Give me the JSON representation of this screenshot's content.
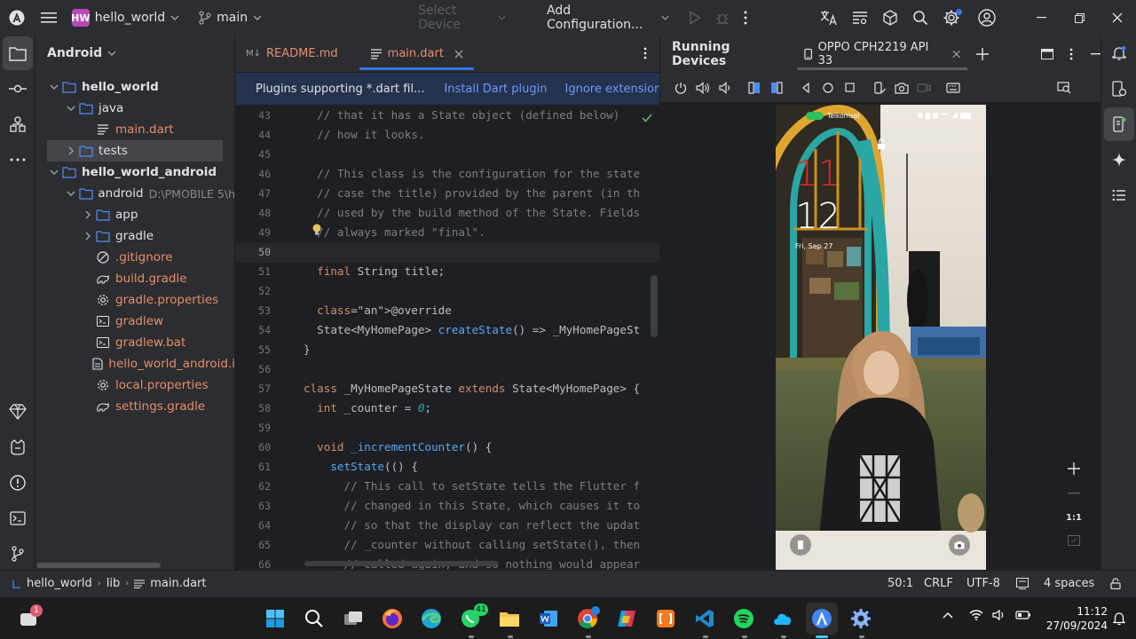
{
  "titlebar": {
    "project_badge": "HW",
    "project_name": "hello_world",
    "branch": "main",
    "device_select": "Select Device",
    "config": "Add Configuration..."
  },
  "project_panel": {
    "view_name": "Android",
    "tree": [
      {
        "label": "hello_world",
        "type": "folder",
        "level": 0,
        "expanded": true
      },
      {
        "label": "java",
        "type": "folder",
        "level": 1,
        "expanded": true
      },
      {
        "label": "main.dart",
        "type": "dart",
        "level": 2
      },
      {
        "label": "tests",
        "type": "folder",
        "level": 1,
        "expanded": false
      },
      {
        "label": "hello_world_android",
        "type": "folder",
        "level": 0,
        "expanded": true
      },
      {
        "label": "android",
        "type": "folder",
        "level": 1,
        "expanded": true,
        "path": "D:\\PMOBILE 5\\h"
      },
      {
        "label": "app",
        "type": "folder",
        "level": 2,
        "expanded": false
      },
      {
        "label": "gradle",
        "type": "folder",
        "level": 2,
        "expanded": false
      },
      {
        "label": ".gitignore",
        "type": "ignore",
        "level": 2
      },
      {
        "label": "build.gradle",
        "type": "gradle",
        "level": 2
      },
      {
        "label": "gradle.properties",
        "type": "props",
        "level": 2
      },
      {
        "label": "gradlew",
        "type": "term",
        "level": 2
      },
      {
        "label": "gradlew.bat",
        "type": "term",
        "level": 2
      },
      {
        "label": "hello_world_android.i",
        "type": "file",
        "level": 2
      },
      {
        "label": "local.properties",
        "type": "props",
        "level": 2
      },
      {
        "label": "settings.gradle",
        "type": "gradle",
        "level": 2
      }
    ]
  },
  "editor": {
    "tabs": [
      {
        "label": "README.md",
        "prefix": "M↓",
        "active": false
      },
      {
        "label": "main.dart",
        "active": true
      }
    ],
    "banner": {
      "text": "Plugins supporting *.dart fil...",
      "action1": "Install Dart plugin",
      "action2": "Ignore extension"
    },
    "lines": [
      {
        "n": "43",
        "code": "  // that it has a State object (defined below) "
      },
      {
        "n": "44",
        "code": "  // how it looks."
      },
      {
        "n": "45",
        "code": ""
      },
      {
        "n": "46",
        "code": "  // This class is the configuration for the state"
      },
      {
        "n": "47",
        "code": "  // case the title) provided by the parent (in th"
      },
      {
        "n": "48",
        "code": "  // used by the build method of the State. Fields"
      },
      {
        "n": "49",
        "code": "  // always marked \"final\"."
      },
      {
        "n": "50",
        "code": ""
      },
      {
        "n": "51",
        "code": "  final String title;"
      },
      {
        "n": "52",
        "code": ""
      },
      {
        "n": "53",
        "code": "  @override"
      },
      {
        "n": "54",
        "code": "  State<MyHomePage> createState() => _MyHomePageSt"
      },
      {
        "n": "55",
        "code": "}"
      },
      {
        "n": "56",
        "code": ""
      },
      {
        "n": "57",
        "code": "class _MyHomePageState extends State<MyHomePage> {"
      },
      {
        "n": "58",
        "code": "  int _counter = 0;"
      },
      {
        "n": "59",
        "code": ""
      },
      {
        "n": "60",
        "code": "  void _incrementCounter() {"
      },
      {
        "n": "61",
        "code": "    setState(() {"
      },
      {
        "n": "62",
        "code": "      // This call to setState tells the Flutter f"
      },
      {
        "n": "63",
        "code": "      // changed in this State, which causes it to"
      },
      {
        "n": "64",
        "code": "      // so that the display can reflect the updat"
      },
      {
        "n": "65",
        "code": "      // _counter without calling setState(), then"
      },
      {
        "n": "66",
        "code": "      // called again, and so nothing would appear"
      }
    ]
  },
  "devices": {
    "title": "Running Devices",
    "device_tab": "OPPO CPH2219 API 33",
    "phone": {
      "carrier": "Telkomsel",
      "hour": "11",
      "minute": "12",
      "date": "Fri, Sep 27"
    },
    "zoom_label": "1:1"
  },
  "statusbar": {
    "breadcrumb": [
      "hello_world",
      "lib",
      "main.dart"
    ],
    "position": "50:1",
    "line_sep": "CRLF",
    "encoding": "UTF-8",
    "indent": "4 spaces"
  },
  "taskbar": {
    "time": "11:12",
    "date": "27/09/2024",
    "chat_badge": "1",
    "whatsapp_badge": "41"
  },
  "colors": {
    "accent": "#3574f0",
    "modified_file": "#e88c6c",
    "dart_file": "#e88c6c"
  }
}
